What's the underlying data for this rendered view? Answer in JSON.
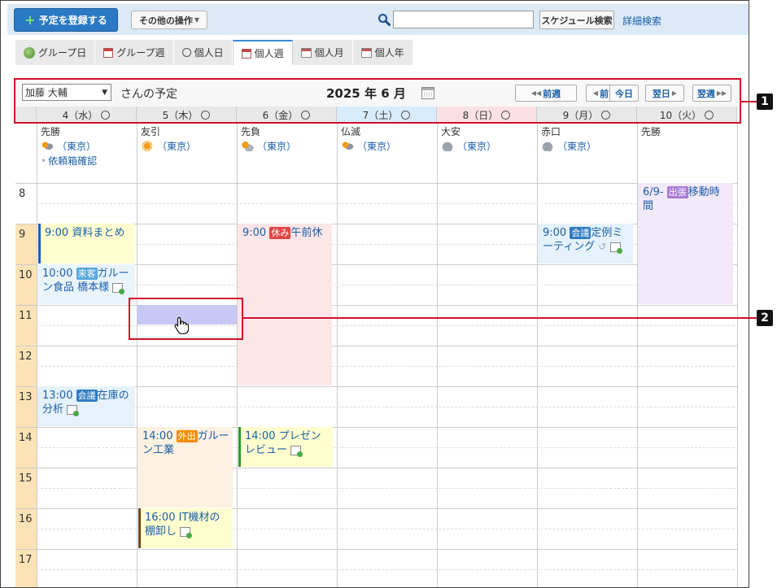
{
  "toolbar": {
    "register_label": "予定を登録する",
    "other_label": "その他の操作",
    "search_value": "",
    "search_button": "スケジュール検索",
    "advanced_link": "詳細検索"
  },
  "tabs": [
    {
      "label": "グループ日",
      "icon": "group-day-icon"
    },
    {
      "label": "グループ週",
      "icon": "group-week-icon"
    },
    {
      "label": "個人日",
      "icon": "clock-icon"
    },
    {
      "label": "個人週",
      "icon": "calendar-week-icon",
      "active": true
    },
    {
      "label": "個人月",
      "icon": "calendar-month-icon"
    },
    {
      "label": "個人年",
      "icon": "calendar-year-icon"
    }
  ],
  "header": {
    "user": "加藤 大輔",
    "san": "さんの予定",
    "month_title": "2025 年 6 月",
    "prev_week": "前週",
    "prev_day": "前日",
    "today": "今日",
    "next_day": "翌日",
    "next_week": "翌週"
  },
  "days": [
    {
      "label": "4（水）",
      "type": "weekday",
      "rokuyo": "先勝",
      "weather": "rain",
      "weather_text": "（東京）",
      "todo": "依頼箱確認"
    },
    {
      "label": "5（木）",
      "type": "weekday",
      "rokuyo": "友引",
      "weather": "sun",
      "weather_text": "（東京）"
    },
    {
      "label": "6（金）",
      "type": "weekday",
      "rokuyo": "先負",
      "weather": "sun-cloud",
      "weather_text": "（東京）"
    },
    {
      "label": "7（土）",
      "type": "sat",
      "rokuyo": "仏滅",
      "weather": "rain",
      "weather_text": "（東京）"
    },
    {
      "label": "8（日）",
      "type": "sun",
      "rokuyo": "大安",
      "weather": "cloud",
      "weather_text": "（東京）"
    },
    {
      "label": "9（月）",
      "type": "weekday",
      "rokuyo": "赤口",
      "weather": "cloud",
      "weather_text": "（東京）"
    },
    {
      "label": "10（火）",
      "type": "weekday",
      "rokuyo": "先勝"
    }
  ],
  "hours": [
    "8",
    "9",
    "10",
    "11",
    "12",
    "13",
    "14",
    "15",
    "16",
    "17"
  ],
  "events": {
    "e1": {
      "time": "9:00",
      "title": "資料まとめ"
    },
    "e2": {
      "time": "10:00",
      "badge": "来客",
      "title": "ガルーン食品 橋本様"
    },
    "e3": {
      "time": "13:00",
      "badge": "会議",
      "title": "在庫の分析"
    },
    "e4": {
      "time": "9:00",
      "badge": "休み",
      "title": "午前休"
    },
    "e5": {
      "time": "14:00",
      "badge": "外出",
      "title": "ガルーン工業"
    },
    "e6": {
      "time": "16:00",
      "title": "IT機材の棚卸し"
    },
    "e7": {
      "time": "14:00",
      "title": "プレゼンレビュー"
    },
    "e8": {
      "time": "9:00",
      "badge": "会議",
      "title": "定例ミーティング"
    },
    "e9": {
      "time": "6/9-",
      "badge": "出張",
      "title": "移動時間"
    }
  },
  "callouts": [
    "1",
    "2"
  ],
  "colors": {
    "accent": "#2a79c4",
    "callout": "#d0112b",
    "selection": "#c8c8f4"
  }
}
